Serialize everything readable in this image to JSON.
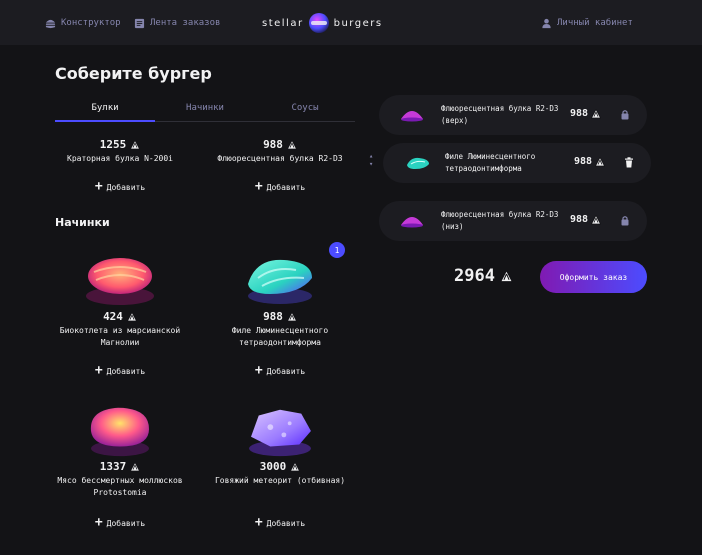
{
  "header": {
    "nav": [
      {
        "label": "Конструктор"
      },
      {
        "label": "Лента заказов"
      }
    ],
    "logo": {
      "left": "stellar",
      "right": "burgers"
    },
    "account": {
      "label": "Личный кабинет"
    }
  },
  "main": {
    "title": "Соберите бургер",
    "tabs": [
      {
        "label": "Булки",
        "active": true
      },
      {
        "label": "Начинки",
        "active": false
      },
      {
        "label": "Соусы",
        "active": false
      }
    ],
    "buns": [
      {
        "price": "1255",
        "name": "Краторная булка N-200i",
        "add_label": "Добавить"
      },
      {
        "price": "988",
        "name": "Флюоресцентная булка R2-D3",
        "add_label": "Добавить"
      }
    ],
    "fillings_title": "Начинки",
    "fillings": [
      {
        "price": "424",
        "name": "Биокотлета из марсианской Магнолии",
        "add_label": "Добавить",
        "count": ""
      },
      {
        "price": "988",
        "name": "Филе Люминесцентного тетраодонтимформа",
        "add_label": "Добавить",
        "count": "1"
      },
      {
        "price": "1337",
        "name": "Мясо бессмертных моллюсков Protostomia",
        "add_label": "Добавить",
        "count": ""
      },
      {
        "price": "3000",
        "name": "Говяжий метеорит (отбивная)",
        "add_label": "Добавить",
        "count": ""
      }
    ]
  },
  "constructor": {
    "top": {
      "name": "Флюоресцентная булка R2-D3 (верх)",
      "price": "988"
    },
    "middle": [
      {
        "name": "Филе Люминесцентного тетраодонтимформа",
        "price": "988"
      }
    ],
    "bottom": {
      "name": "Флюоресцентная булка R2-D3 (низ)",
      "price": "988"
    },
    "total": "2964",
    "order_button": "Оформить заказ"
  },
  "colors": {
    "background": "#131316",
    "panel": "#1c1c21",
    "accent": "#4c4cff",
    "button_gradient_start": "#801ab2",
    "muted_text": "#8585ad"
  }
}
